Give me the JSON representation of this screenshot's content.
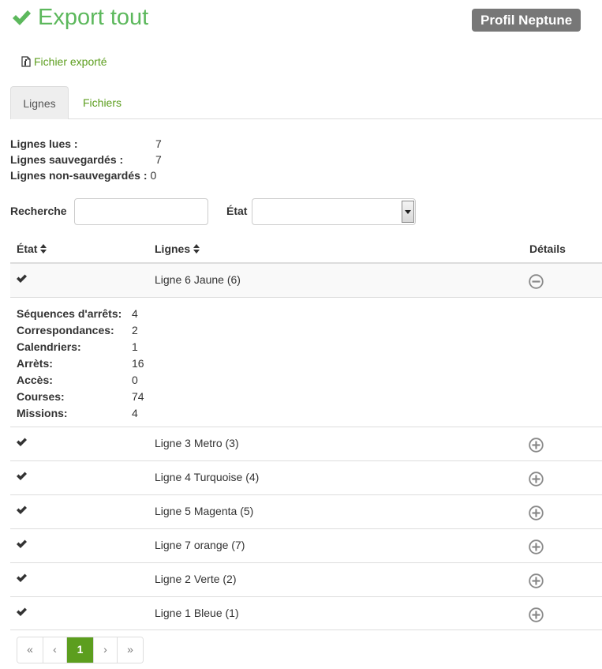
{
  "header": {
    "title": "Export tout",
    "profile_badge": "Profil Neptune"
  },
  "export_link": {
    "label": "Fichier exporté"
  },
  "tabs": [
    {
      "label": "Lignes",
      "active": true
    },
    {
      "label": "Fichiers",
      "active": false
    }
  ],
  "stats": [
    {
      "label": "Lignes lues :",
      "value": "7"
    },
    {
      "label": "Lignes sauvegardés :",
      "value": "7"
    },
    {
      "label": "Lignes non-sauvegardés :",
      "value": "0"
    }
  ],
  "filters": {
    "search_label": "Recherche",
    "search_value": "",
    "state_label": "État",
    "state_value": ""
  },
  "table": {
    "headers": {
      "state": "État",
      "lines": "Lignes",
      "details": "Détails"
    },
    "rows": [
      {
        "name": "Ligne 6 Jaune (6)",
        "expanded": true
      },
      {
        "name": "Ligne 3 Metro (3)",
        "expanded": false
      },
      {
        "name": "Ligne 4 Turquoise (4)",
        "expanded": false
      },
      {
        "name": "Ligne 5 Magenta (5)",
        "expanded": false
      },
      {
        "name": "Ligne 7 orange (7)",
        "expanded": false
      },
      {
        "name": "Ligne 2 Verte (2)",
        "expanded": false
      },
      {
        "name": "Ligne 1 Bleue (1)",
        "expanded": false
      }
    ],
    "details": [
      {
        "label": "Séquences d'arrêts:",
        "value": "4"
      },
      {
        "label": "Correspondances:",
        "value": "2"
      },
      {
        "label": "Calendriers:",
        "value": "1"
      },
      {
        "label": "Arrèts:",
        "value": "16"
      },
      {
        "label": "Accès:",
        "value": "0"
      },
      {
        "label": "Courses:",
        "value": "74"
      },
      {
        "label": "Missions:",
        "value": "4"
      }
    ]
  },
  "pagination": {
    "first": "«",
    "prev": "‹",
    "current": "1",
    "next": "›",
    "last": "»"
  },
  "colors": {
    "accent": "#5cb85c",
    "link": "#5c9e1e",
    "badge": "#777777"
  },
  "icons": {
    "title": "check-icon",
    "export": "file-icon",
    "sort": "sort-icon",
    "row_state": "check-icon",
    "collapse": "minus-circle-icon",
    "expand": "plus-circle-icon"
  }
}
